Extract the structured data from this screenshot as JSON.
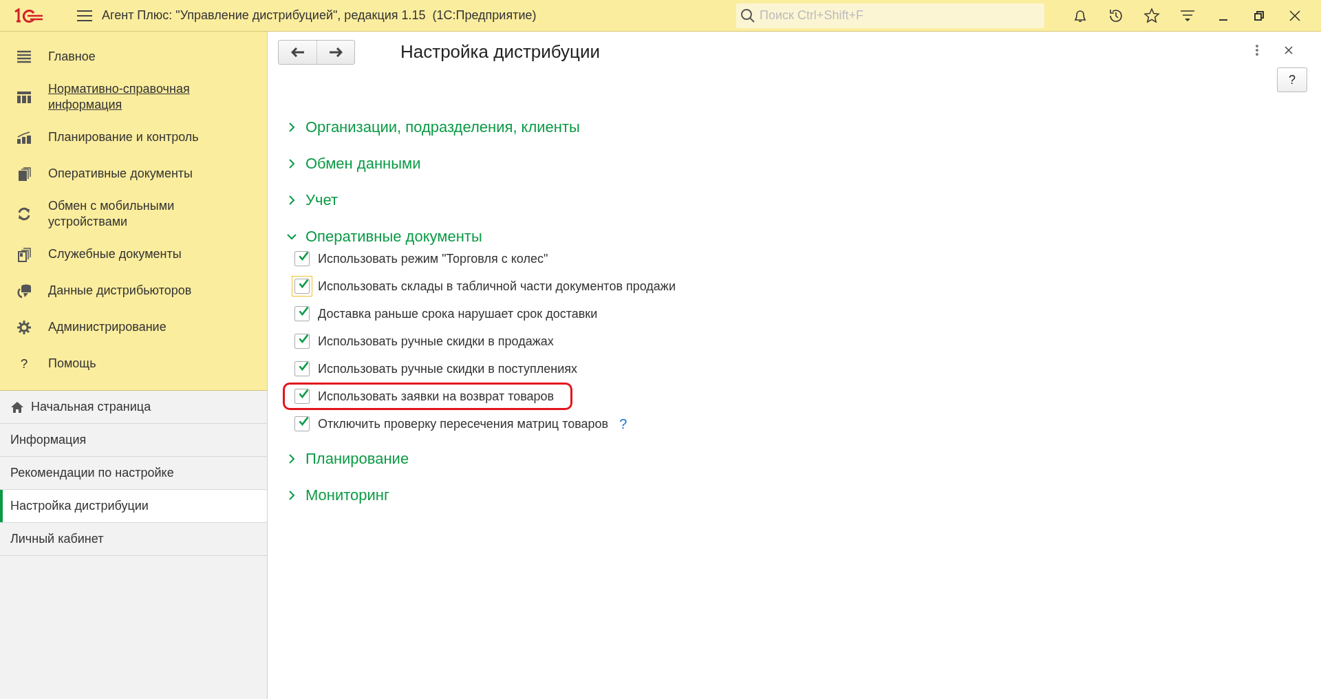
{
  "window": {
    "title": "Агент Плюс: \"Управление дистрибуцией\", редакция 1.15  (1С:Предприятие)",
    "search": {
      "placeholder": "Поиск Ctrl+Shift+F"
    }
  },
  "sidebar": {
    "sections": [
      {
        "label": "Главное",
        "hovered": false
      },
      {
        "label": "Нормативно-справочная информация",
        "hovered": true
      },
      {
        "label": "Планирование и контроль",
        "hovered": false
      },
      {
        "label": "Оперативные документы",
        "hovered": false
      },
      {
        "label": "Обмен с мобильными устройствами",
        "hovered": false
      },
      {
        "label": "Служебные документы",
        "hovered": false
      },
      {
        "label": "Данные дистрибьюторов",
        "hovered": false
      },
      {
        "label": "Администрирование",
        "hovered": false
      },
      {
        "label": "Помощь",
        "hovered": false,
        "glyph": "?"
      }
    ],
    "pages": [
      {
        "label": "Начальная страница",
        "selected": false,
        "home": true
      },
      {
        "label": "Информация",
        "selected": false
      },
      {
        "label": "Рекомендации по настройке",
        "selected": false
      },
      {
        "label": "Настройка дистрибуции",
        "selected": true
      },
      {
        "label": "Личный кабинет",
        "selected": false
      }
    ]
  },
  "form": {
    "title": "Настройка дистрибуции",
    "help_button": "?",
    "groups": [
      {
        "label": "Организации, подразделения, клиенты",
        "expanded": false
      },
      {
        "label": "Обмен данными",
        "expanded": false
      },
      {
        "label": "Учет",
        "expanded": false
      },
      {
        "label": "Оперативные документы",
        "expanded": true,
        "options": [
          {
            "label": "Использовать режим \"Торговля с колес\"",
            "checked": true,
            "focused": false,
            "highlighted": false
          },
          {
            "label": "Использовать склады в табличной части документов продажи",
            "checked": true,
            "focused": true,
            "highlighted": false
          },
          {
            "label": "Доставка раньше срока нарушает срок доставки",
            "checked": true,
            "focused": false,
            "highlighted": false
          },
          {
            "label": "Использовать ручные скидки в продажах",
            "checked": true,
            "focused": false,
            "highlighted": false
          },
          {
            "label": "Использовать ручные скидки в поступлениях",
            "checked": true,
            "focused": false,
            "highlighted": false
          },
          {
            "label": "Использовать заявки на возврат товаров",
            "checked": true,
            "focused": false,
            "highlighted": true
          },
          {
            "label": "Отключить проверку пересечения матриц товаров",
            "checked": true,
            "focused": false,
            "highlighted": false,
            "help": "?"
          }
        ]
      },
      {
        "label": "Планирование",
        "expanded": false
      },
      {
        "label": "Мониторинг",
        "expanded": false
      }
    ]
  }
}
